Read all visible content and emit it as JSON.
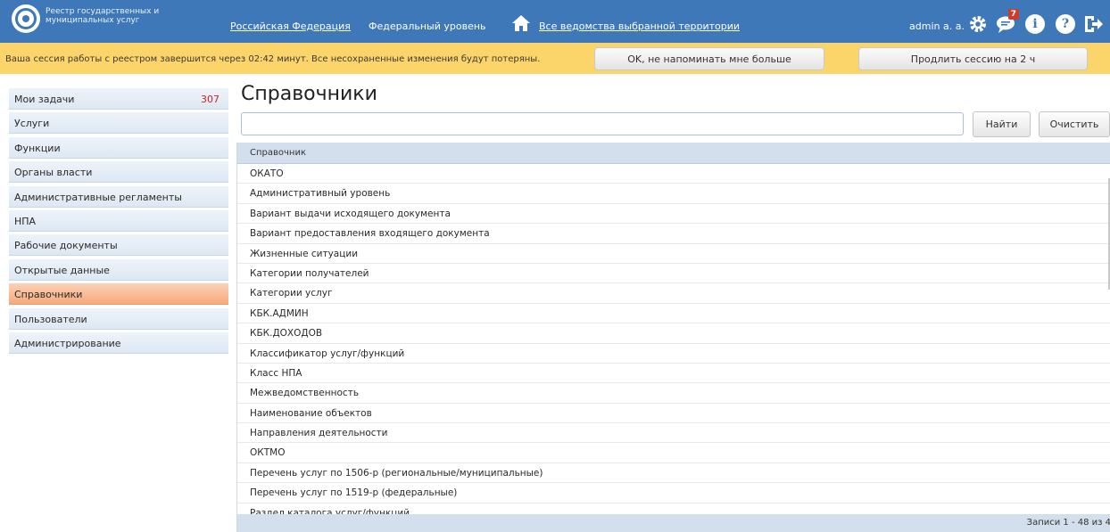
{
  "header": {
    "app_title": "Реестр государственных и муниципальных услуг",
    "territory": "Российская Федерация",
    "level": "Федеральный уровень",
    "departments": "Все ведомства выбранной территории",
    "user": "admin a. a.",
    "messages_count": "7",
    "icons": [
      "logo-icon",
      "home-icon",
      "gear-icon",
      "chat-icon",
      "info-icon",
      "help-icon",
      "logout-icon"
    ]
  },
  "session": {
    "message": "Ваша сессия работы с реестром завершится через 02:42 минут. Все несохраненные изменения будут потеряны.",
    "dismiss_label": "OK, не напоминать мне больше",
    "extend_label": "Продлить сессию на 2 ч"
  },
  "sidebar": {
    "items": [
      {
        "label": "Мои задачи",
        "count": "307"
      },
      {
        "label": "Услуги"
      },
      {
        "label": "Функции"
      },
      {
        "label": "Органы власти"
      },
      {
        "label": "Административные регламенты"
      },
      {
        "label": "НПА"
      },
      {
        "label": "Рабочие документы"
      },
      {
        "label": "Открытые данные"
      },
      {
        "label": "Справочники",
        "active": true
      },
      {
        "label": "Пользователи"
      },
      {
        "label": "Администрирование"
      }
    ]
  },
  "main": {
    "title": "Справочники",
    "search": {
      "value": "",
      "placeholder": ""
    },
    "find_label": "Найти",
    "clear_label": "Очистить",
    "table": {
      "column": "Справочник",
      "rows": [
        "ОКАТО",
        "Административный уровень",
        "Вариант выдачи исходящего документа",
        "Вариант предоставления входящего документа",
        "Жизненные ситуации",
        "Категории получателей",
        "Категории услуг",
        "КБК.АДМИН",
        "КБК.ДОХОДОВ",
        "Классификатор услуг/функций",
        "Класс НПА",
        "Межведомственность",
        "Наименование объектов",
        "Направления деятельности",
        "ОКТМО",
        "Перечень услуг по 1506-р (региональные/муниципальные)",
        "Перечень услуг по 1519-р (федеральные)",
        "Раздел каталога услуг/функций"
      ],
      "footer": "Записи 1 - 48 из 4"
    }
  },
  "colors": {
    "header": "#3e78b8",
    "session_bar": "#fbd46a",
    "active_item": "#f6a97c",
    "count": "#d02020"
  }
}
